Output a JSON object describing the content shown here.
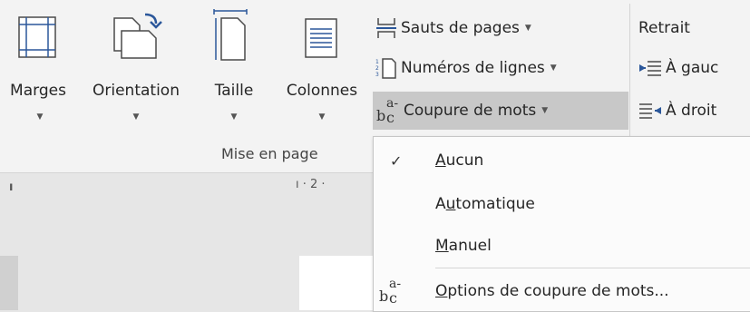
{
  "ribbon": {
    "buttons": {
      "margins": "Marges",
      "orientation": "Orientation",
      "size": "Taille",
      "columns": "Colonnes"
    },
    "small": {
      "breaks": "Sauts de pages",
      "line_numbers": "Numéros de lignes",
      "hyphenation": "Coupure de mots"
    },
    "group_label": "Mise en page",
    "indent": {
      "title": "Retrait",
      "left": "À gauc",
      "right": "À droit"
    }
  },
  "ruler": {
    "tick_2": "2"
  },
  "hyphenation_menu": {
    "none": {
      "pre": "",
      "key": "A",
      "post": "ucun"
    },
    "automatic": {
      "pre": "A",
      "key": "u",
      "post": "tomatique"
    },
    "manual": {
      "pre": "",
      "key": "M",
      "post": "anuel"
    },
    "options": {
      "pre": "",
      "key": "O",
      "post": "ptions de coupure de mots..."
    },
    "checkmark": "✓"
  },
  "colors": {
    "accent": "#2b579a",
    "ribbon": "#f3f3f3",
    "background": "#e6e6e6"
  }
}
